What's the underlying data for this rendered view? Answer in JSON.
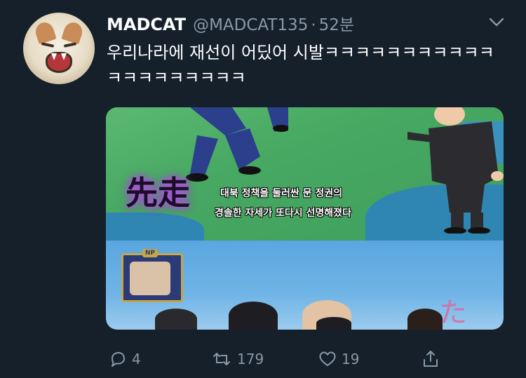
{
  "tweet": {
    "display_name": "MADCAT",
    "handle": "@MADCAT135",
    "separator": "·",
    "time": "52분",
    "text": "우리나라에 재선이 어딨어 시발ㅋㅋㅋㅋㅋㅋㅋㅋㅋㅋㅋㅋㅋㅋㅋㅋㅋㅋㅋㅋ",
    "avatar_icon": "cat-avatar",
    "menu_icon": "chevron-down-icon"
  },
  "media": {
    "caption_big": "先走",
    "caption_line1": "대북 정책을 둘러싼 문 정권의",
    "caption_line2": "경솔한 자세가 또다시 선명해졌다",
    "badge": "NP",
    "overlay_glyph": "た"
  },
  "actions": {
    "reply": {
      "icon": "reply-icon",
      "count": "4"
    },
    "retweet": {
      "icon": "retweet-icon",
      "count": "179"
    },
    "like": {
      "icon": "heart-icon",
      "count": "19"
    },
    "share": {
      "icon": "share-icon"
    }
  },
  "colors": {
    "background": "#15202b",
    "secondary_text": "#8899a6",
    "primary_text": "#ffffff"
  }
}
